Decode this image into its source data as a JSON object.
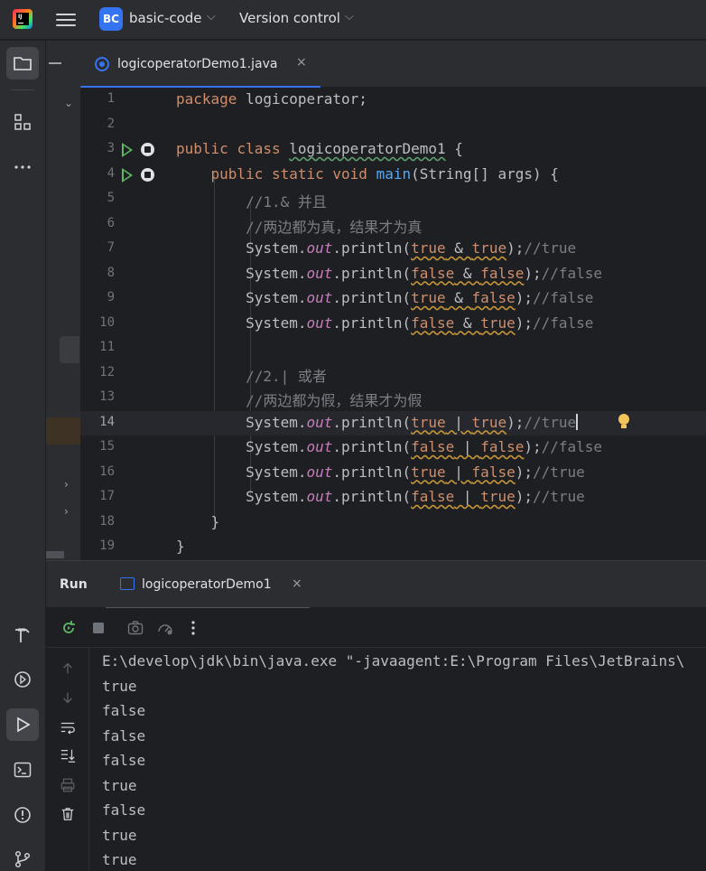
{
  "titlebar": {
    "project_badge": "BC",
    "project_name": "basic-code",
    "vcs_label": "Version control"
  },
  "editor": {
    "tab_label": "logicoperatorDemo1.java",
    "tab_close": "×",
    "lines": [
      {
        "n": "1"
      },
      {
        "n": "2"
      },
      {
        "n": "3"
      },
      {
        "n": "4"
      },
      {
        "n": "5"
      },
      {
        "n": "6"
      },
      {
        "n": "7"
      },
      {
        "n": "8"
      },
      {
        "n": "9"
      },
      {
        "n": "10"
      },
      {
        "n": "11"
      },
      {
        "n": "12"
      },
      {
        "n": "13"
      },
      {
        "n": "14"
      },
      {
        "n": "15"
      },
      {
        "n": "16"
      },
      {
        "n": "17"
      },
      {
        "n": "18"
      },
      {
        "n": "19"
      }
    ],
    "tokens": {
      "package": "package",
      "pkg_name": " logicoperator;",
      "public": "public",
      "class": "class",
      "class_name": "logicoperatorDemo1",
      "brace_open": " {",
      "static": "static",
      "void": "void",
      "main": "main",
      "main_args": "(String[] args) {",
      "c1": "//1.& 并且",
      "c2": "//两边都为真，结果才为真",
      "c3": "//2.| 或者",
      "c4": "//两边都为假，结果才为假",
      "sys": "System.",
      "out": "out",
      "println": ".println(",
      "close": ");",
      "t": "true",
      "f": "false",
      "and": " & ",
      "or": " | ",
      "r7": "//true",
      "r8": "//false",
      "r9": "//false",
      "r10": "//false",
      "r14": "//true",
      "r15": "//false",
      "r16": "//true",
      "r17": "//true",
      "brace_close": "}"
    }
  },
  "run": {
    "title": "Run",
    "tab_label": "logicoperatorDemo1",
    "tab_close": "×",
    "console": [
      "E:\\develop\\jdk\\bin\\java.exe \"-javaagent:E:\\Program Files\\JetBrains\\",
      "true",
      "false",
      "false",
      "false",
      "true",
      "false",
      "true",
      "true"
    ]
  },
  "icons": {
    "left_tools": [
      "folder-icon",
      "structure-icon",
      "more-icon",
      "build-icon",
      "services-icon",
      "run-icon",
      "terminal-icon",
      "problems-icon",
      "git-icon"
    ],
    "run_toolbar": [
      "rerun-icon",
      "stop-icon",
      "screenshot-icon",
      "profiler-icon",
      "more-vert-icon"
    ],
    "run_side": [
      "up-icon",
      "down-icon",
      "soft-wrap-icon",
      "scroll-end-icon",
      "print-icon",
      "trash-icon"
    ]
  },
  "colors": {
    "accent": "#3574f0",
    "keyword": "#cf8e6d",
    "method": "#56a8f5",
    "field": "#c77dbb",
    "comment": "#7a7e85",
    "run_green": "#5fb865"
  }
}
